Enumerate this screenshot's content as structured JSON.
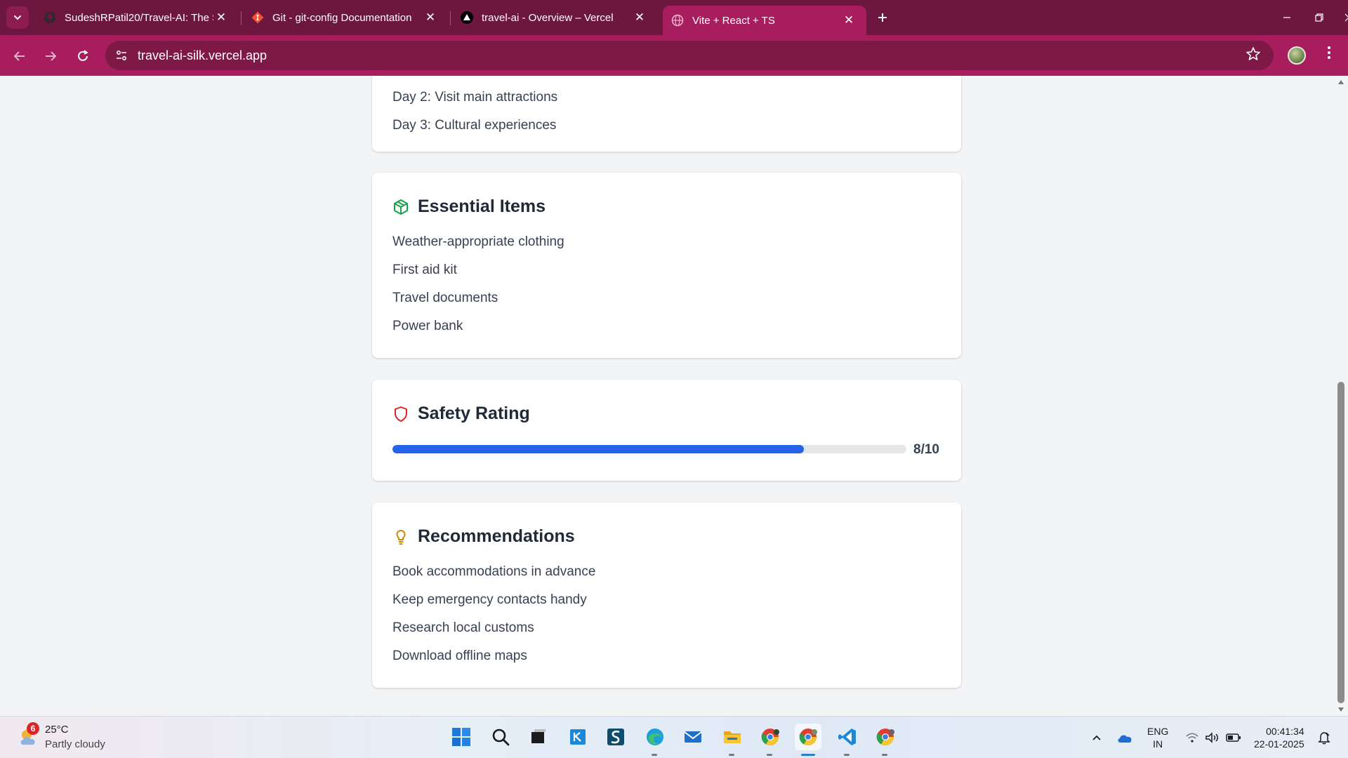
{
  "browser": {
    "tabs": [
      {
        "title": "SudeshRPatil20/Travel-AI: The S",
        "icon": "github-icon"
      },
      {
        "title": "Git - git-config Documentation",
        "icon": "git-icon"
      },
      {
        "title": "travel-ai - Overview – Vercel",
        "icon": "vercel-icon"
      },
      {
        "title": "Vite + React + TS",
        "icon": "globe-icon",
        "active": true
      }
    ],
    "url": "travel-ai-silk.vercel.app"
  },
  "itinerary": {
    "items": [
      "Day 2: Visit main attractions",
      "Day 3: Cultural experiences"
    ]
  },
  "essentials": {
    "title": "Essential Items",
    "items": [
      "Weather-appropriate clothing",
      "First aid kit",
      "Travel documents",
      "Power bank"
    ]
  },
  "safety": {
    "title": "Safety Rating",
    "rating": 8,
    "max": 10,
    "label": "8/10"
  },
  "recommendations": {
    "title": "Recommendations",
    "items": [
      "Book accommodations in advance",
      "Keep emergency contacts handy",
      "Research local customs",
      "Download offline maps"
    ]
  },
  "taskbar": {
    "weather": {
      "badge": "6",
      "temp": "25°C",
      "desc": "Partly cloudy"
    },
    "lang": {
      "line1": "ENG",
      "line2": "IN"
    },
    "clock": {
      "time": "00:41:34",
      "date": "22-01-2025"
    }
  },
  "colors": {
    "tabbar": "#6d1640",
    "toolbar": "#a81d5d",
    "progress": "#2563eb",
    "essentials_icon": "#16a34a",
    "safety_icon": "#dc2626",
    "recommend_icon": "#ca8a04"
  }
}
